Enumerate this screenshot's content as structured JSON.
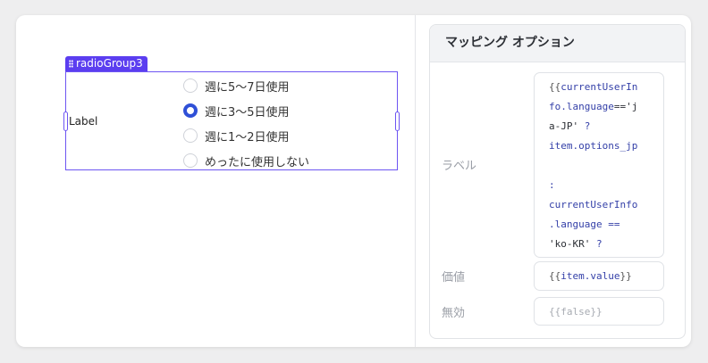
{
  "canvas": {
    "component_name": "radioGroup3",
    "label": "Label",
    "options": [
      {
        "text": "週に5〜7日使用",
        "selected": false
      },
      {
        "text": "週に3〜5日使用",
        "selected": true
      },
      {
        "text": "週に1〜2日使用",
        "selected": false
      },
      {
        "text": "めったに使用しない",
        "selected": false
      }
    ]
  },
  "panel": {
    "title": "マッピング オプション",
    "label_field": {
      "name": "ラベル",
      "code_lines": [
        [
          {
            "t": "{{",
            "c": "br"
          },
          {
            "t": "currentUserIn",
            "c": "kw"
          }
        ],
        [
          {
            "t": "fo.language",
            "c": "kw"
          },
          {
            "t": "=='j",
            "c": "st"
          }
        ],
        [
          {
            "t": "a-JP'",
            "c": "st"
          },
          {
            "t": " ?",
            "c": "kw"
          }
        ],
        [
          {
            "t": "item.options_jp",
            "c": "kw"
          }
        ],
        [
          {
            "t": "",
            "c": "kw"
          }
        ],
        [
          {
            "t": ":",
            "c": "kw"
          }
        ],
        [
          {
            "t": "currentUserInfo",
            "c": "kw"
          }
        ],
        [
          {
            "t": ".language ==",
            "c": "kw"
          }
        ],
        [
          {
            "t": "'ko-KR'",
            "c": "st"
          },
          {
            "t": " ?",
            "c": "kw"
          }
        ]
      ]
    },
    "value_field": {
      "name": "価値",
      "code_lines": [
        [
          {
            "t": "{{",
            "c": "br"
          },
          {
            "t": "item.value",
            "c": "kw"
          },
          {
            "t": "}}",
            "c": "br"
          }
        ]
      ]
    },
    "disabled_field": {
      "name": "無効",
      "code_lines": [
        [
          {
            "t": "{{false}}",
            "c": "muted"
          }
        ]
      ]
    }
  }
}
